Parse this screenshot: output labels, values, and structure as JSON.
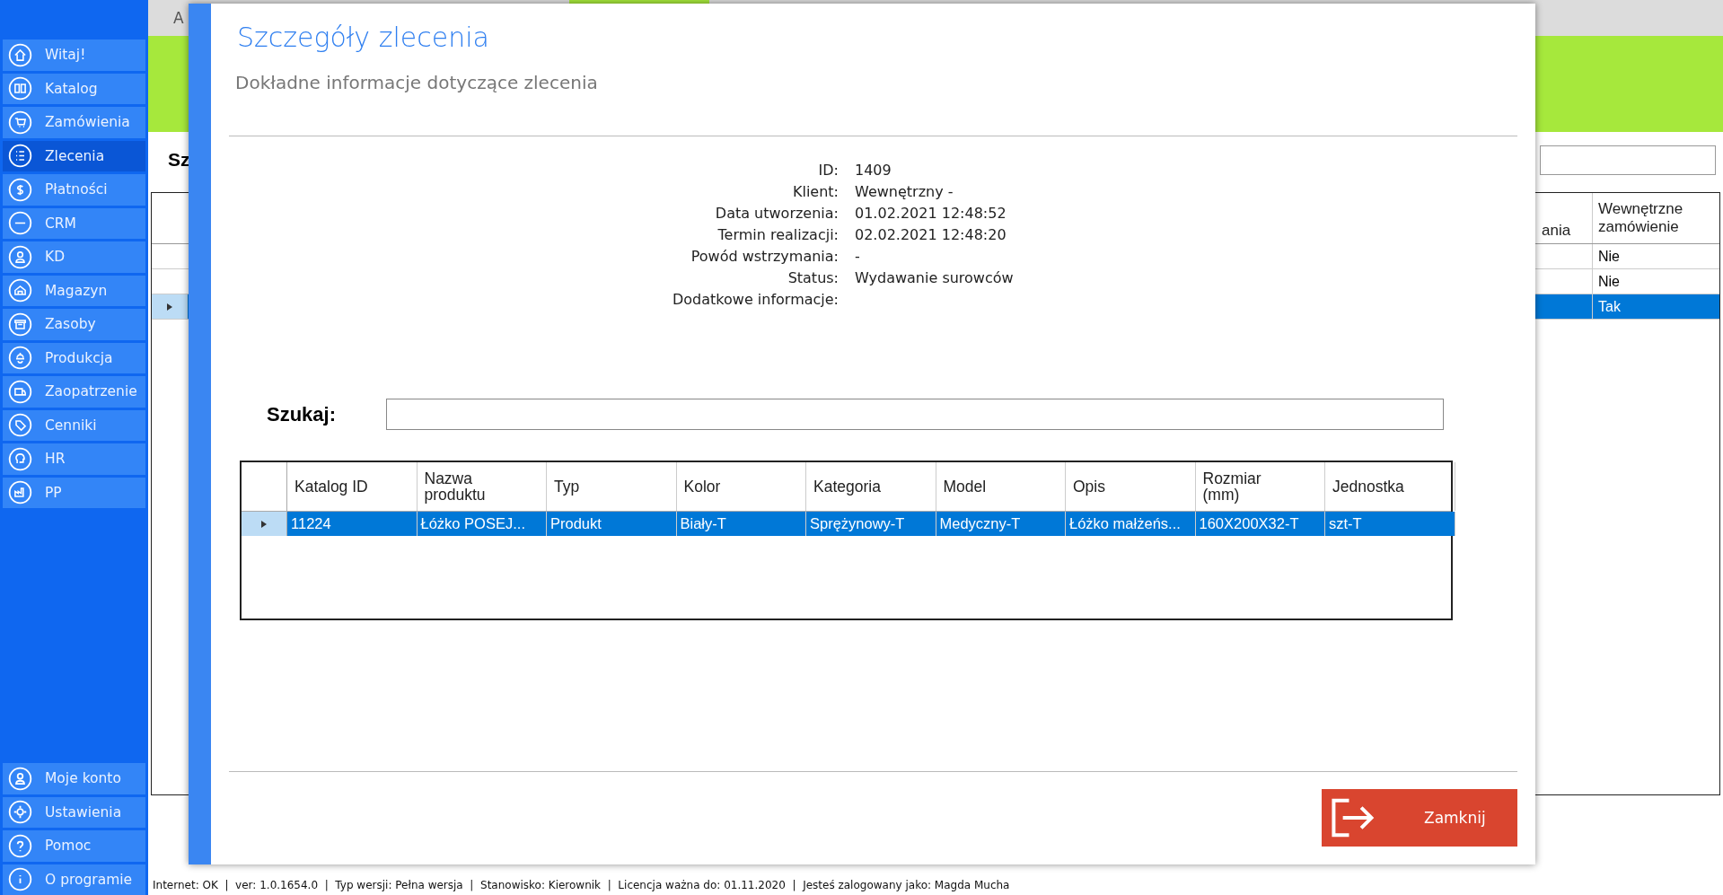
{
  "sidebar": {
    "items": [
      {
        "label": "Witaj!",
        "selected": false
      },
      {
        "label": "Katalog",
        "selected": false
      },
      {
        "label": "Zamówienia",
        "selected": false
      },
      {
        "label": "Zlecenia",
        "selected": true
      },
      {
        "label": "Płatności",
        "selected": false
      },
      {
        "label": "CRM",
        "selected": false
      },
      {
        "label": "KD",
        "selected": false
      },
      {
        "label": "Magazyn",
        "selected": false
      },
      {
        "label": "Zasoby",
        "selected": false
      },
      {
        "label": "Produkcja",
        "selected": false
      },
      {
        "label": "Zaopatrzenie",
        "selected": false
      },
      {
        "label": "Cenniki",
        "selected": false
      },
      {
        "label": "HR",
        "selected": false
      },
      {
        "label": "PP",
        "selected": false
      }
    ],
    "bottom_items": [
      {
        "label": "Moje konto",
        "selected": false
      },
      {
        "label": "Ustawienia",
        "selected": false
      },
      {
        "label": "Pomoc",
        "selected": false
      },
      {
        "label": "O programie",
        "selected": false
      }
    ]
  },
  "background": {
    "tab_label": "A",
    "heading": "Sz",
    "table": {
      "columns": [
        "ania",
        "Wewnętrzne zamówienie"
      ],
      "rows": [
        {
          "value": "Nie",
          "selected": false
        },
        {
          "value": "Nie",
          "selected": false
        },
        {
          "value": "Tak",
          "selected": true
        }
      ]
    }
  },
  "dialog": {
    "title": "Szczegóły zlecenia",
    "subtitle": "Dokładne informacje dotyczące zlecenia",
    "details": [
      {
        "label": "ID:",
        "value": "1409"
      },
      {
        "label": "Klient:",
        "value": "Wewnętrzny -"
      },
      {
        "label": "Data utworzenia:",
        "value": "01.02.2021 12:48:52"
      },
      {
        "label": "Termin realizacji:",
        "value": "02.02.2021 12:48:20"
      },
      {
        "label": "Powód wstrzymania:",
        "value": "-"
      },
      {
        "label": "Status:",
        "value": "Wydawanie surowców"
      },
      {
        "label": "Dodatkowe informacje:"
      }
    ],
    "search": {
      "label": "Szukaj:"
    },
    "table": {
      "columns": [
        "Katalog ID",
        "Nazwa produktu",
        "Typ",
        "Kolor",
        "Kategoria",
        "Model",
        "Opis",
        "Rozmiar (mm)",
        "Jednostka"
      ],
      "rows": [
        {
          "cells": [
            "11224",
            "Łóżko POSEJ...",
            "Produkt",
            "Biały-T",
            "Sprężynowy-T",
            "Medyczny-T",
            "Łóżko małżeńs...",
            "160X200X32-T",
            "szt-T"
          ],
          "selected": true
        }
      ]
    },
    "close_button": "Zamknij"
  },
  "status_bar": "Internet: OK  |  ver: 1.0.1654.0  |  Typ wersji: Pełna wersja  |  Stanowisko: Kierownik  |  Licencja ważna do: 01.11.2020  |  Jesteś zalogowany jako: Magda Mucha"
}
